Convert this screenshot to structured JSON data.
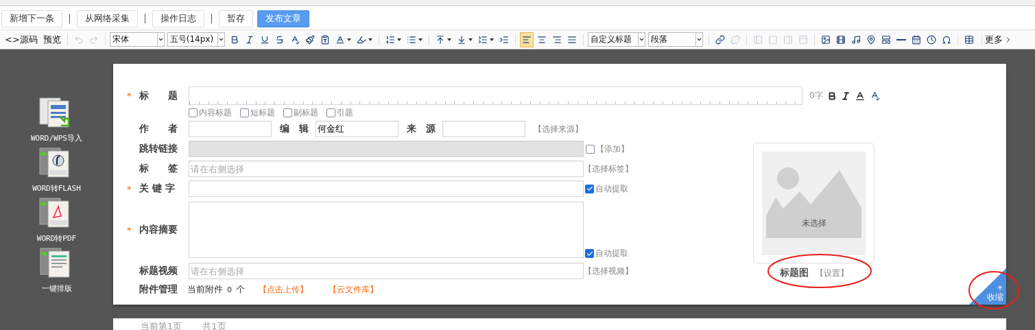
{
  "actions": [
    {
      "label": "新增下一条",
      "primary": false
    },
    {
      "label": "从网络采集",
      "primary": false
    },
    {
      "label": "操作日志",
      "primary": false
    },
    {
      "label": "暂存",
      "primary": false
    },
    {
      "label": "发布文章",
      "primary": true
    }
  ],
  "toolbar": {
    "groups": [
      [
        {
          "kind": "text",
          "label": "<>源码"
        },
        {
          "kind": "text",
          "label": "预览"
        }
      ],
      [
        {
          "kind": "icon",
          "disabled": true
        },
        {
          "kind": "icon",
          "disabled": true
        }
      ],
      [
        {
          "kind": "select",
          "label": "宋体"
        },
        {
          "kind": "select",
          "label": "五号(14px)"
        },
        {
          "kind": "icon",
          "disabled": false
        },
        {
          "kind": "icon",
          "disabled": false
        },
        {
          "kind": "icon",
          "disabled": false
        },
        {
          "kind": "icon",
          "disabled": false
        },
        {
          "kind": "icon",
          "disabled": false
        },
        {
          "kind": "icon",
          "disabled": false
        },
        {
          "kind": "icon",
          "disabled": false
        },
        {
          "kind": "icon",
          "disabled": false,
          "dropdown": true
        },
        {
          "kind": "icon",
          "disabled": false,
          "dropdown": true
        }
      ],
      [
        {
          "kind": "icon",
          "disabled": false,
          "dropdown": true
        },
        {
          "kind": "icon",
          "disabled": false,
          "dropdown": true
        }
      ],
      [
        {
          "kind": "icon",
          "disabled": false,
          "dropdown": true
        },
        {
          "kind": "icon",
          "disabled": false,
          "dropdown": true
        },
        {
          "kind": "icon",
          "disabled": false,
          "dropdown": true
        },
        {
          "kind": "icon",
          "disabled": false
        }
      ],
      [
        {
          "kind": "icon",
          "disabled": false,
          "selected": true
        },
        {
          "kind": "icon",
          "disabled": false,
          "selected": false
        },
        {
          "kind": "icon",
          "disabled": false,
          "selected": false
        },
        {
          "kind": "icon",
          "disabled": false,
          "selected": false
        }
      ],
      [
        {
          "kind": "select",
          "label": "自定义标题"
        },
        {
          "kind": "select",
          "label": "段落"
        }
      ],
      [
        {
          "kind": "icon",
          "disabled": false
        },
        {
          "kind": "icon",
          "disabled": true
        }
      ],
      [
        {
          "kind": "icon",
          "disabled": true
        },
        {
          "kind": "icon",
          "disabled": true
        },
        {
          "kind": "icon",
          "disabled": true
        },
        {
          "kind": "icon",
          "disabled": true
        }
      ],
      [
        {
          "kind": "icon",
          "disabled": false
        },
        {
          "kind": "icon",
          "disabled": false
        },
        {
          "kind": "icon",
          "disabled": false
        },
        {
          "kind": "icon",
          "disabled": false
        },
        {
          "kind": "icon",
          "disabled": false
        },
        {
          "kind": "icon",
          "disabled": false
        },
        {
          "kind": "icon",
          "disabled": false
        },
        {
          "kind": "icon",
          "disabled": false
        },
        {
          "kind": "icon",
          "disabled": false
        }
      ],
      [
        {
          "kind": "icon",
          "disabled": false
        },
        {
          "kind": "more",
          "label": "更多"
        }
      ]
    ]
  },
  "sidebar": {
    "items": [
      {
        "label": "WORD/WPS导入"
      },
      {
        "label": "WORD转FLASH"
      },
      {
        "label": "WORD转PDF"
      },
      {
        "label": "一键排版"
      }
    ]
  },
  "form": {
    "required_mark": "*",
    "title": {
      "label": "标　　题",
      "required": true,
      "counter": "0字",
      "options": [
        {
          "label": "内容标题",
          "checked": false
        },
        {
          "label": "短标题",
          "checked": false
        },
        {
          "label": "副标题",
          "checked": false
        },
        {
          "label": "引题",
          "checked": false
        }
      ]
    },
    "author": {
      "label": "作　　者",
      "editor_label": "编　辑",
      "editor": "何金红",
      "source_label": "来　源",
      "source_link": "【选择来源】"
    },
    "jump_link": {
      "label": "跳转链接",
      "disabled": true,
      "checked": false,
      "link": "【添加】"
    },
    "tags": {
      "label": "标　　签",
      "placeholder": "请在右侧选择",
      "link": "【选择标签】"
    },
    "keywords": {
      "label": "关 键 字",
      "required": true,
      "auto": {
        "label": "自动提取",
        "checked": true
      }
    },
    "summary": {
      "label": "内容摘要",
      "required": true,
      "auto": {
        "label": "自动提取",
        "checked": true
      }
    },
    "video": {
      "label": "标题视频",
      "placeholder": "请在右侧选择",
      "link": "【选择视频】"
    },
    "attachments": {
      "label": "附件管理",
      "current": "当前附件",
      "count": "0",
      "unit": "个",
      "upload": "【点击上传】",
      "cloud": "【云文件库】"
    }
  },
  "thumbnail": {
    "status": "未选择",
    "label": "标题图",
    "link": "【设置】"
  },
  "collapse": {
    "label": "收缩"
  },
  "pager": {
    "current": "当前第1页",
    "total": "共1页"
  }
}
